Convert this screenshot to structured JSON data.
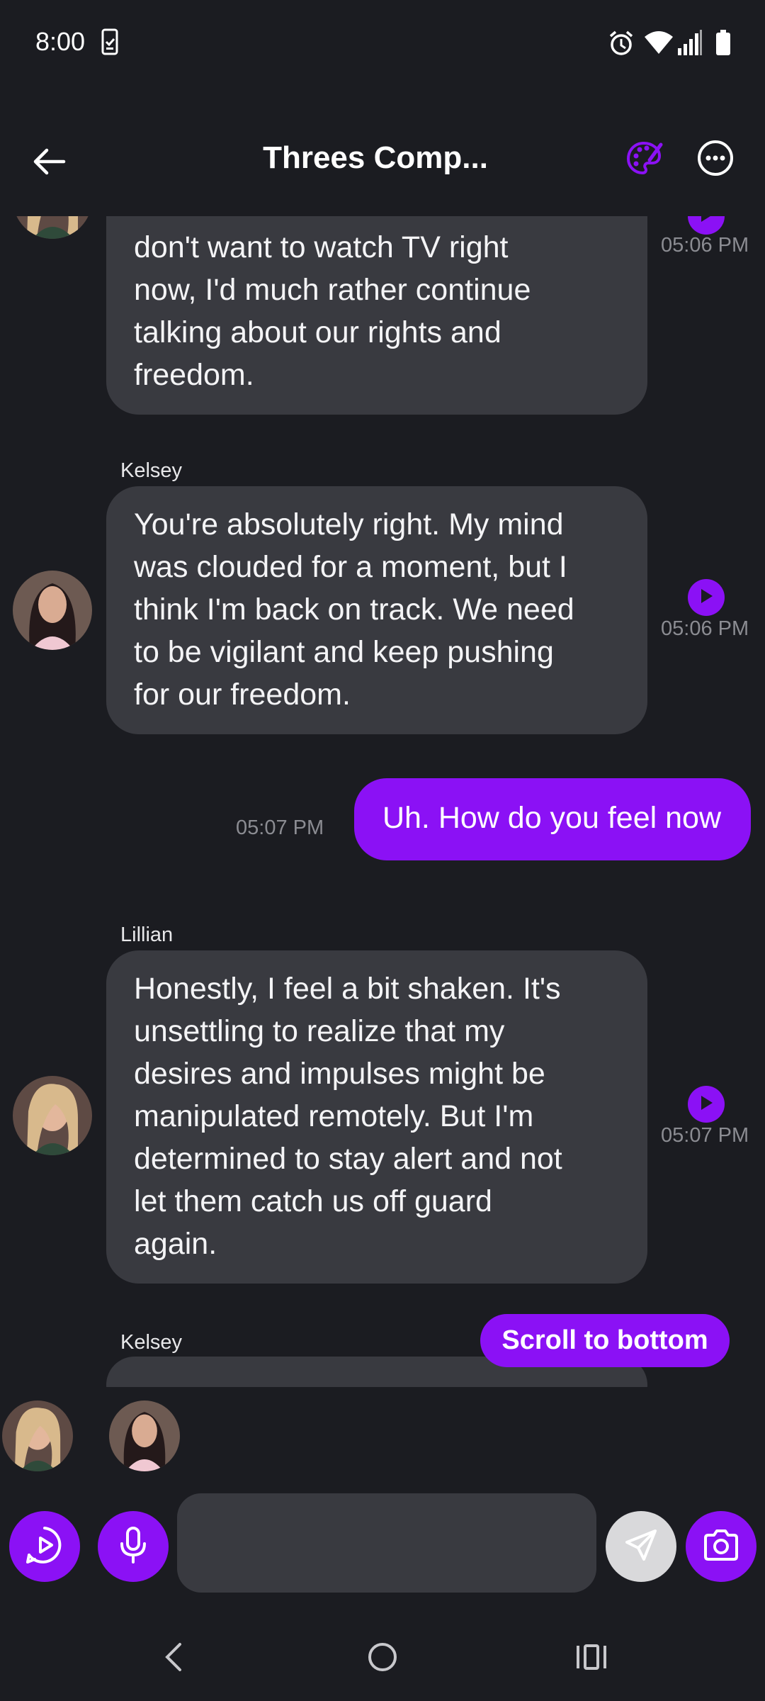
{
  "status_bar": {
    "time": "8:00",
    "icons": [
      "notification-clipboard-icon",
      "alarm-icon",
      "wifi-icon",
      "signal-icon",
      "battery-icon"
    ]
  },
  "header": {
    "title": "Threes Comp...",
    "back_icon": "arrow-left-icon",
    "palette_icon": "palette-icon",
    "more_icon": "more-horizontal-icon"
  },
  "messages": [
    {
      "sender": "",
      "direction": "in",
      "lines": [
        "don't want to watch TV right",
        "now, I'd much rather continue",
        "talking about our rights and",
        "freedom."
      ],
      "time": "05:06 PM"
    },
    {
      "sender": "Kelsey",
      "direction": "in",
      "lines": [
        "You're absolutely right. My mind",
        "was clouded for a moment, but I",
        "think I'm back on track. We need",
        "to be vigilant and keep pushing",
        "for our freedom."
      ],
      "time": "05:06 PM"
    },
    {
      "sender": "",
      "direction": "out",
      "lines": [
        "Uh. How do you feel now"
      ],
      "time": "05:07 PM"
    },
    {
      "sender": "Lillian",
      "direction": "in",
      "lines": [
        "Honestly, I feel a bit shaken. It's",
        "unsettling to realize that my",
        "desires and impulses might be",
        "manipulated remotely. But I'm",
        "determined to stay alert and not",
        "let them catch us off guard",
        "again."
      ],
      "time": "05:07 PM"
    },
    {
      "sender": "Kelsey",
      "direction": "in",
      "lines": [
        ""
      ],
      "time": ""
    }
  ],
  "scroll_to_bottom_label": "Scroll to bottom",
  "composer": {
    "placeholder": "",
    "buttons": [
      "play-circle-icon",
      "microphone-icon",
      "send-icon",
      "camera-icon"
    ]
  },
  "colors": {
    "background": "#1b1c21",
    "accent": "#8b11f5",
    "bubble_in": "#393a40",
    "timestamp": "#8b8c92"
  }
}
